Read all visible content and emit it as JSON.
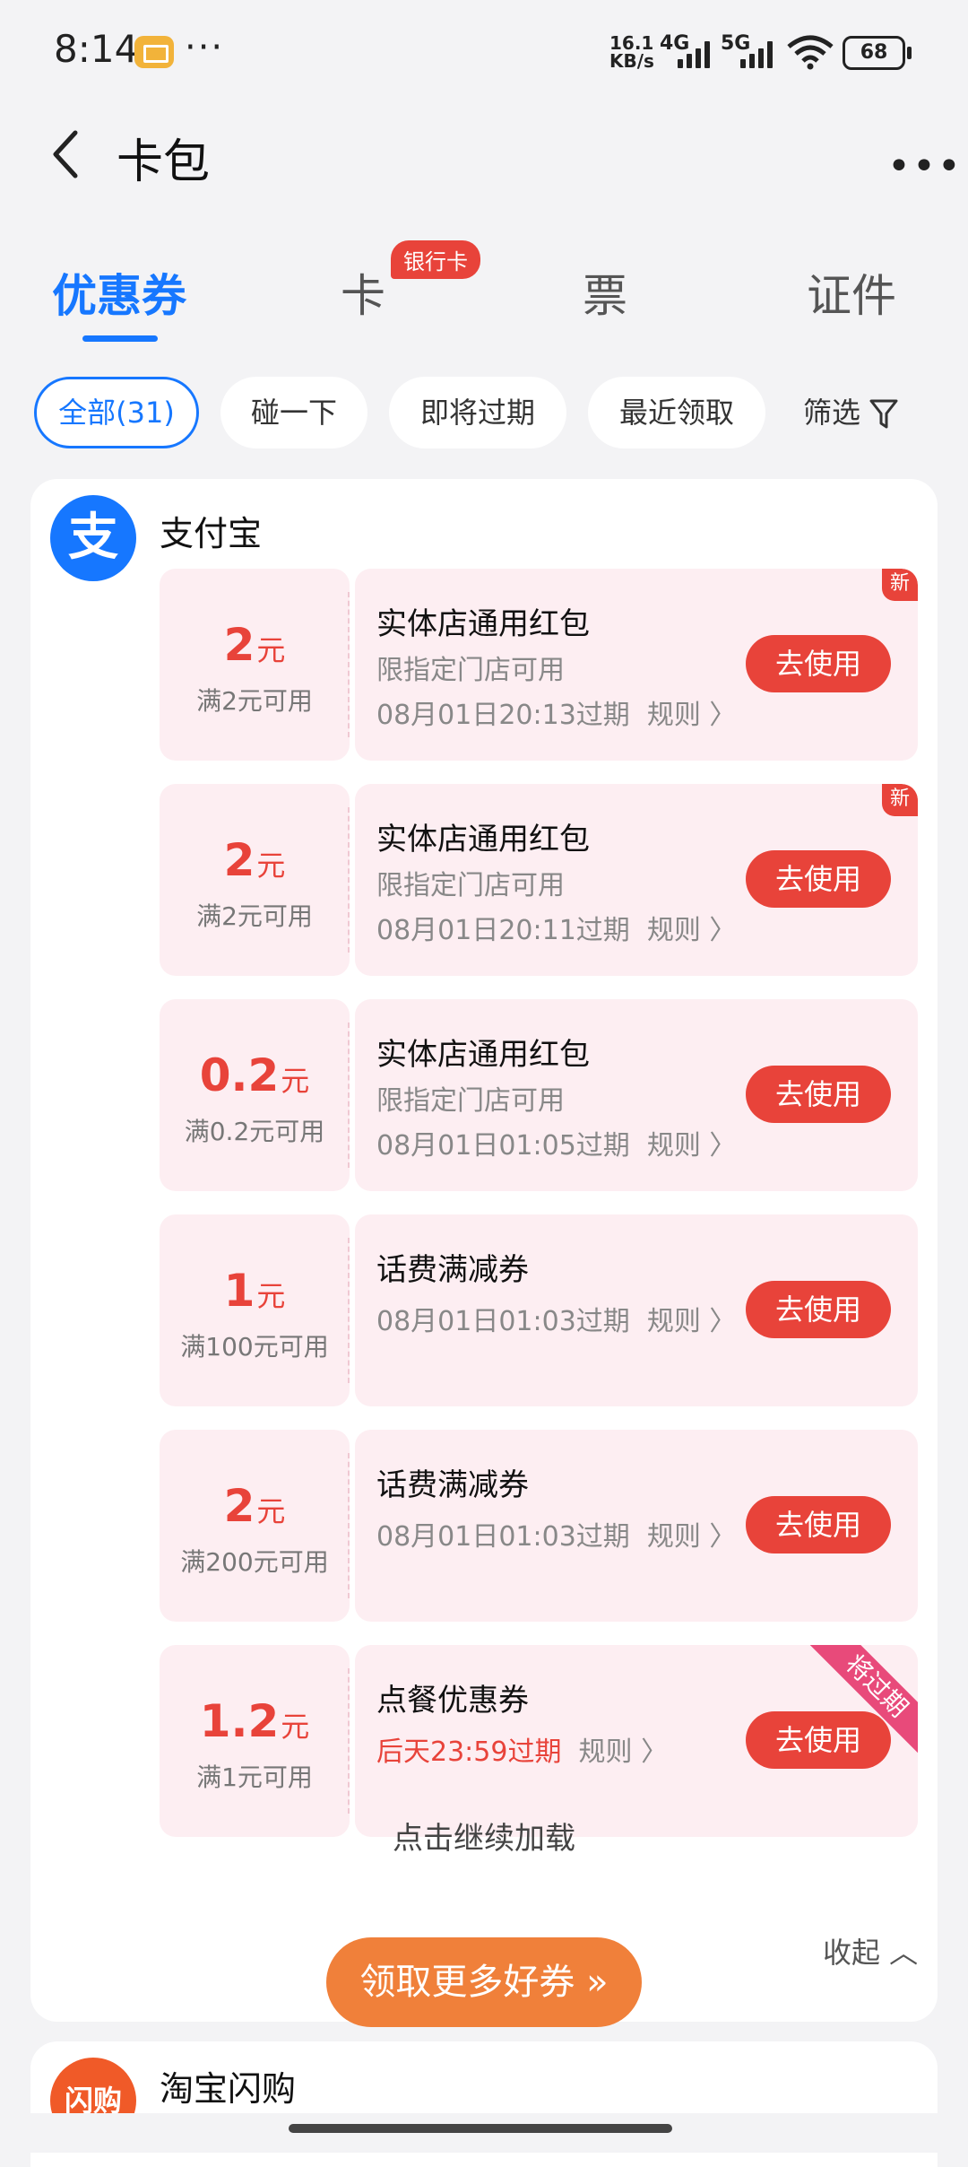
{
  "status": {
    "time": "8:14",
    "net_speed_top": "16.1",
    "net_speed_bottom": "KB/s",
    "sig1": "4G",
    "sig2": "5G",
    "battery": "68"
  },
  "header": {
    "title": "卡包"
  },
  "tabs": [
    {
      "label": "优惠券"
    },
    {
      "label": "卡",
      "badge": "银行卡"
    },
    {
      "label": "票"
    },
    {
      "label": "证件"
    }
  ],
  "chips": [
    {
      "label": "全部(31)"
    },
    {
      "label": "碰一下"
    },
    {
      "label": "即将过期"
    },
    {
      "label": "最近领取"
    }
  ],
  "filter_label": "筛选",
  "merchant": {
    "logo_char": "支",
    "name": "支付宝"
  },
  "coupons": [
    {
      "amount": "2",
      "unit": "元",
      "cond": "满2元可用",
      "name": "实体店通用红包",
      "sub": "限指定门店可用",
      "expiry": "08月01日20:13过期",
      "rule": "规则 〉",
      "button": "去使用",
      "tag": "新"
    },
    {
      "amount": "2",
      "unit": "元",
      "cond": "满2元可用",
      "name": "实体店通用红包",
      "sub": "限指定门店可用",
      "expiry": "08月01日20:11过期",
      "rule": "规则 〉",
      "button": "去使用",
      "tag": "新"
    },
    {
      "amount": "0.2",
      "unit": "元",
      "cond": "满0.2元可用",
      "name": "实体店通用红包",
      "sub": "限指定门店可用",
      "expiry": "08月01日01:05过期",
      "rule": "规则 〉",
      "button": "去使用"
    },
    {
      "amount": "1",
      "unit": "元",
      "cond": "满100元可用",
      "name": "话费满减券",
      "expiry": "08月01日01:03过期",
      "rule": "规则 〉",
      "button": "去使用"
    },
    {
      "amount": "2",
      "unit": "元",
      "cond": "满200元可用",
      "name": "话费满减券",
      "expiry": "08月01日01:03过期",
      "rule": "规则 〉",
      "button": "去使用"
    },
    {
      "amount": "1.2",
      "unit": "元",
      "cond": "满1元可用",
      "name": "点餐优惠券",
      "expiry": "后天23:59过期",
      "rule": "规则 〉",
      "button": "去使用",
      "ribbon": "将过期"
    }
  ],
  "load_more": "点击继续加载",
  "collapse": "收起 ︿",
  "more_coupons_button": "领取更多好券 »",
  "merchant2": {
    "logo_text": "闪购",
    "name": "淘宝闪购"
  },
  "colors": {
    "primary": "#1677ff",
    "danger": "#e8433a",
    "coupon_bg": "#fdeef2",
    "orange": "#f0803a"
  }
}
